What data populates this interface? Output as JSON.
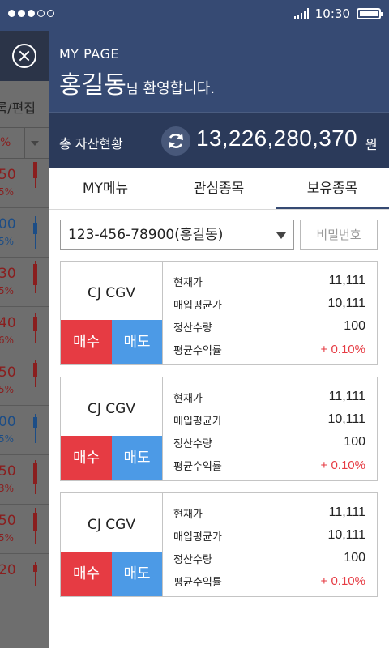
{
  "status_bar": {
    "time": "10:30"
  },
  "background_screen": {
    "edit_label": "록/편집",
    "column_head": "%",
    "rows": [
      {
        "value": "50",
        "pct": "5%",
        "color": "red"
      },
      {
        "value": "00",
        "pct": "5%",
        "color": "blue"
      },
      {
        "value": "30",
        "pct": "5%",
        "color": "red"
      },
      {
        "value": "40",
        "pct": "6%",
        "color": "red"
      },
      {
        "value": "50",
        "pct": "5%",
        "color": "red"
      },
      {
        "value": "00",
        "pct": "5%",
        "color": "blue"
      },
      {
        "value": "50",
        "pct": "3%",
        "color": "red"
      },
      {
        "value": "50",
        "pct": "5%",
        "color": "red"
      },
      {
        "value": "20",
        "pct": "",
        "color": "red"
      }
    ]
  },
  "profile": {
    "section": "MY PAGE",
    "user_name": "홍길동",
    "honorific": "님",
    "welcome": "환영합니다."
  },
  "assets": {
    "label": "총 자산현황",
    "total": "13,226,280,370",
    "unit": "원"
  },
  "tabs": [
    {
      "label": "MY메뉴",
      "active": false
    },
    {
      "label": "관심종목",
      "active": false
    },
    {
      "label": "보유종목",
      "active": true
    }
  ],
  "account": {
    "selected": "123-456-78900(홍길동)",
    "password_placeholder": "비밀번호"
  },
  "holdings": [
    {
      "name": "CJ CGV",
      "buy": "매수",
      "sell": "매도",
      "rows": [
        {
          "label": "현재가",
          "value": "11,111"
        },
        {
          "label": "매입평균가",
          "value": "10,111"
        },
        {
          "label": "정산수량",
          "value": "100"
        },
        {
          "label": "평균수익률",
          "value": "+ 0.10%"
        }
      ]
    },
    {
      "name": "CJ CGV",
      "buy": "매수",
      "sell": "매도",
      "rows": [
        {
          "label": "현재가",
          "value": "11,111"
        },
        {
          "label": "매입평균가",
          "value": "10,111"
        },
        {
          "label": "정산수량",
          "value": "100"
        },
        {
          "label": "평균수익률",
          "value": "+ 0.10%"
        }
      ]
    },
    {
      "name": "CJ CGV",
      "buy": "매수",
      "sell": "매도",
      "rows": [
        {
          "label": "현재가",
          "value": "11,111"
        },
        {
          "label": "매입평균가",
          "value": "10,111"
        },
        {
          "label": "정산수량",
          "value": "100"
        },
        {
          "label": "평균수익률",
          "value": "+ 0.10%"
        }
      ]
    }
  ],
  "colors": {
    "header": "#364a73",
    "buy": "#e63b43",
    "sell": "#4c9ae6",
    "profit": "#e63b43"
  }
}
